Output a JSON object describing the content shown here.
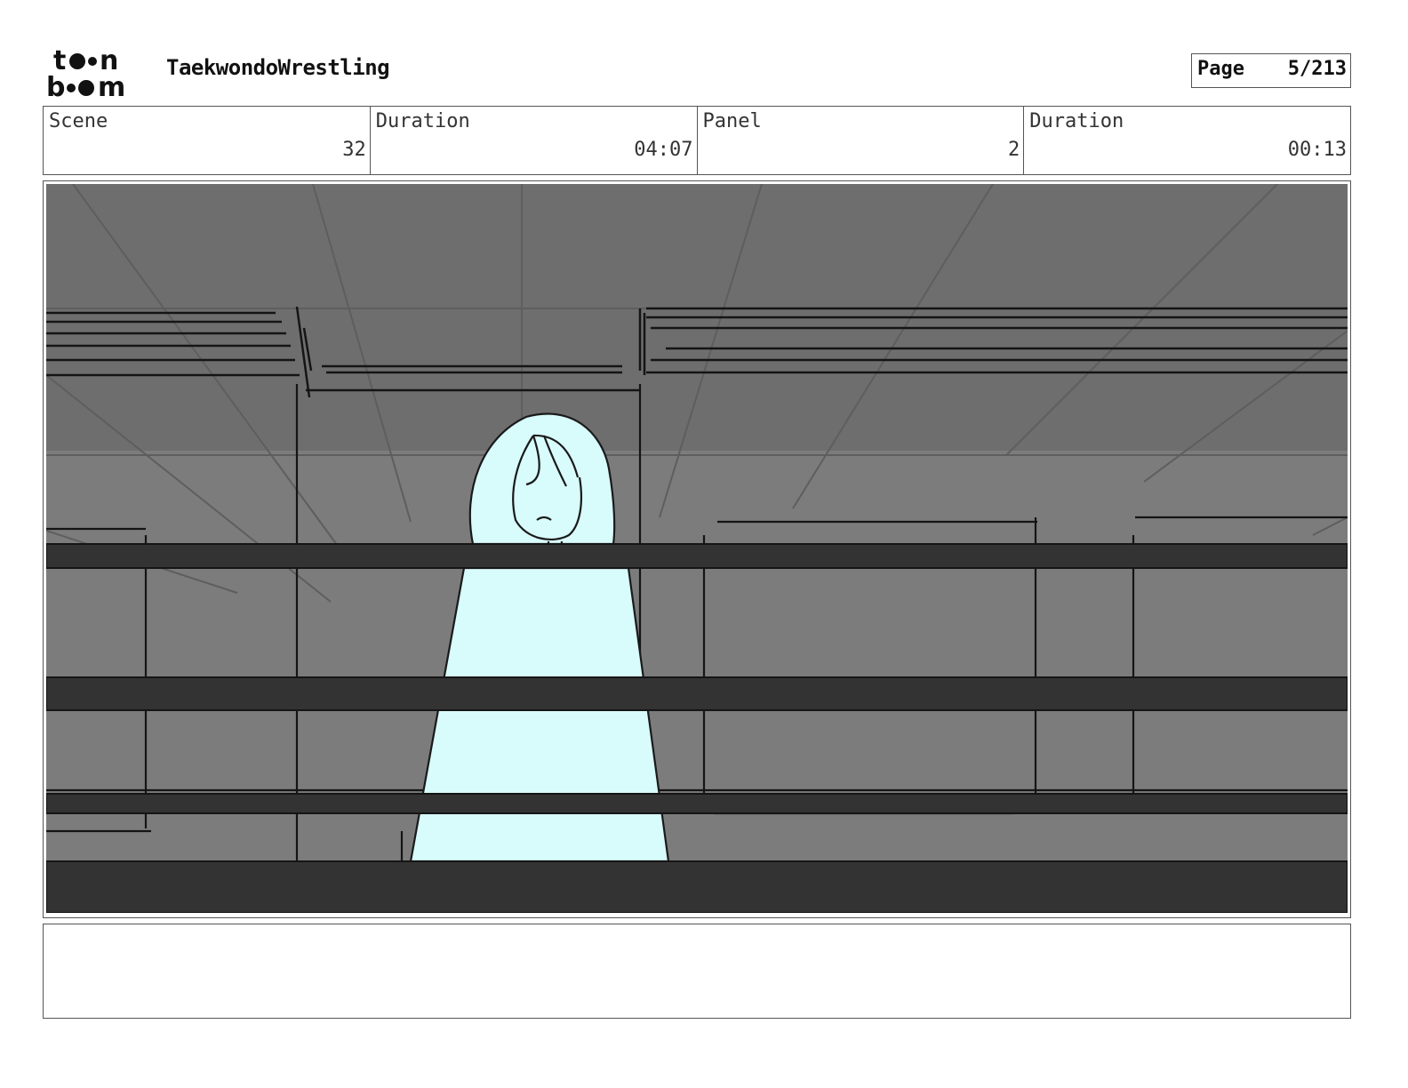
{
  "header": {
    "logo_text": "toon boom",
    "project_title": "TaekwondoWrestling",
    "page_label": "Page",
    "page_value": "5/213"
  },
  "info": {
    "scene_label": "Scene",
    "scene_value": "32",
    "scene_duration_label": "Duration",
    "scene_duration_value": "04:07",
    "panel_label": "Panel",
    "panel_value": "2",
    "panel_duration_label": "Duration",
    "panel_duration_value": "00:13"
  },
  "notes": {
    "text": ""
  },
  "colors": {
    "background_gray": "#7a7a7a",
    "rail_dark": "#333333",
    "figure_cyan": "#d8fbfb"
  }
}
